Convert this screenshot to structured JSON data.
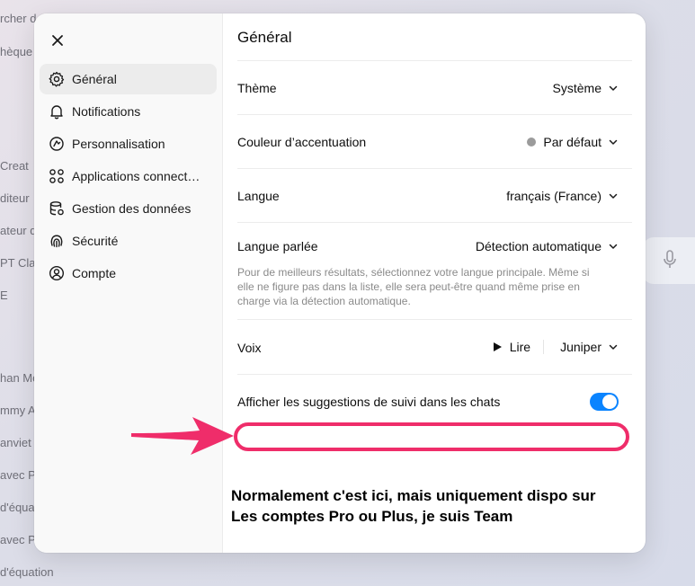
{
  "background": {
    "items": [
      "rcher d",
      "hèque",
      "Creat",
      "diteur",
      "ateur d",
      "PT Cla",
      "E",
      "han Mo",
      "mmy A",
      "anviet",
      "avec P",
      "d'équa",
      "avec P",
      "d'équation"
    ]
  },
  "icons": {
    "close": "close-icon",
    "mic": "microphone-icon",
    "chevron": "chevron-down-icon",
    "play": "play-icon"
  },
  "colors": {
    "toggle_on": "#0a84ff",
    "highlight": "#ef2d6a",
    "accent_dot": "#9b9b9b"
  },
  "sidebar": {
    "items": [
      {
        "label": "Général",
        "icon": "gear-icon",
        "active": true
      },
      {
        "label": "Notifications",
        "icon": "bell-icon",
        "active": false
      },
      {
        "label": "Personnalisation",
        "icon": "personalization-icon",
        "active": false
      },
      {
        "label": "Applications connect…",
        "icon": "apps-icon",
        "active": false
      },
      {
        "label": "Gestion des données",
        "icon": "database-icon",
        "active": false
      },
      {
        "label": "Sécurité",
        "icon": "fingerprint-icon",
        "active": false
      },
      {
        "label": "Compte",
        "icon": "user-circle-icon",
        "active": false
      }
    ]
  },
  "panel": {
    "title": "Général",
    "theme": {
      "label": "Thème",
      "value": "Système"
    },
    "accent": {
      "label": "Couleur d’accentuation",
      "value": "Par défaut"
    },
    "language": {
      "label": "Langue",
      "value": "français (France)"
    },
    "spoken_language": {
      "label": "Langue parlée",
      "value": "Détection automatique",
      "help": "Pour de meilleurs résultats, sélectionnez votre langue principale. Même si elle ne figure pas dans la liste, elle sera peut-être quand même prise en charge via la détection automatique."
    },
    "voice": {
      "label": "Voix",
      "play_label": "Lire",
      "value": "Juniper"
    },
    "suggestions": {
      "label": "Afficher les suggestions de suivi dans les chats",
      "enabled": true
    }
  },
  "annotation": {
    "line1": "Normalement c'est ici, mais uniquement dispo sur",
    "line2": "Les comptes Pro ou Plus, je suis Team"
  }
}
